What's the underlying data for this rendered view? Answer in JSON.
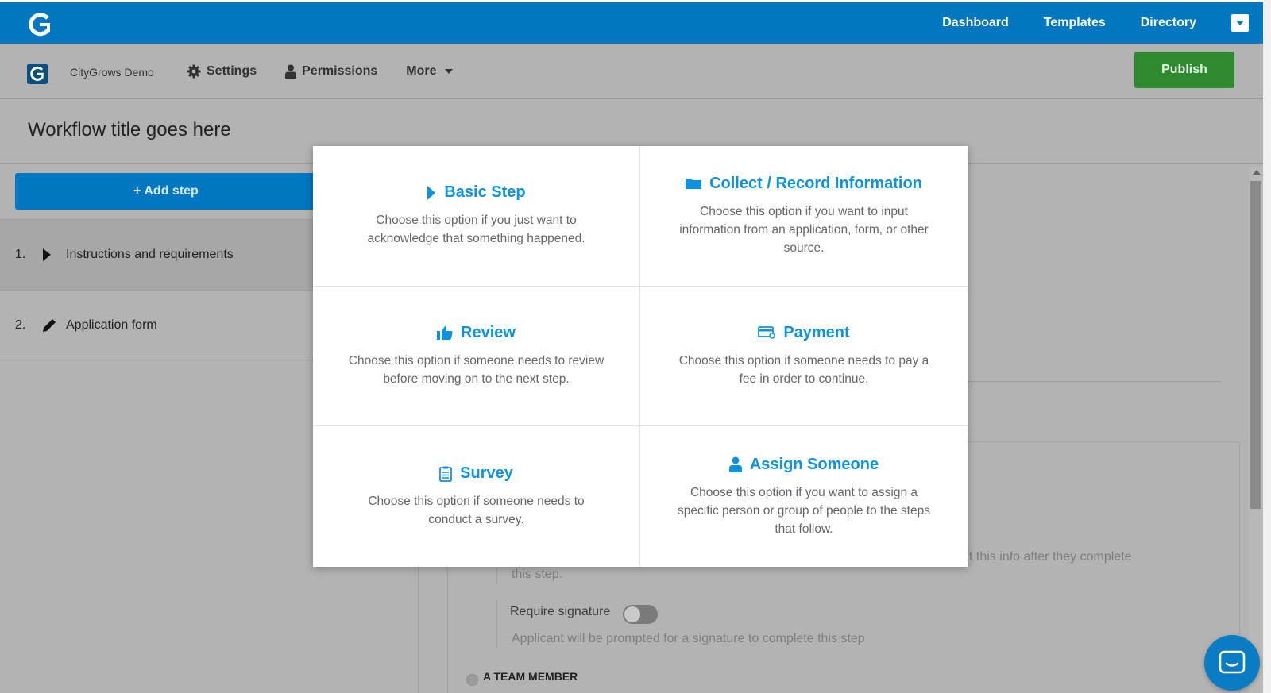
{
  "topnav": {
    "items": [
      "Dashboard",
      "Templates",
      "Directory"
    ]
  },
  "subbar": {
    "org_name": "CityGrows Demo",
    "settings": "Settings",
    "permissions": "Permissions",
    "more": "More",
    "publish": "Publish"
  },
  "workflow": {
    "title": "Workflow title goes here"
  },
  "sidebar": {
    "add_step": "+ Add step",
    "steps": [
      {
        "num": "1.",
        "label": "Instructions and requirements",
        "icon": "play-icon"
      },
      {
        "num": "2.",
        "label": "Application form",
        "icon": "pencil-icon"
      }
    ]
  },
  "background": {
    "edit_note_1": "t this info after they complete",
    "edit_note_2": "this step.",
    "require_signature": "Require signature",
    "signature_note": "Applicant will be prompted for a signature to complete this step",
    "team_member": "A TEAM MEMBER"
  },
  "modal": {
    "options": [
      {
        "title": "Basic Step",
        "icon": "play-icon",
        "desc": "Choose this option if you just want to acknowledge that something happened."
      },
      {
        "title": "Collect / Record Information",
        "icon": "folder-icon",
        "desc": "Choose this option if you want to input information from an application, form, or other source."
      },
      {
        "title": "Review",
        "icon": "thumbs-up-icon",
        "desc": "Choose this option if someone needs to review before moving on to the next step."
      },
      {
        "title": "Payment",
        "icon": "credit-card-icon",
        "desc": "Choose this option if someone needs to pay a fee in order to continue."
      },
      {
        "title": "Survey",
        "icon": "clipboard-icon",
        "desc": "Choose this option if someone needs to conduct a survey."
      },
      {
        "title": "Assign Someone",
        "icon": "user-icon",
        "desc": "Choose this option if you want to assign a specific person or group of people to the steps that follow."
      }
    ]
  },
  "colors": {
    "brand_blue": "#0077c0",
    "link_blue": "#0d93de",
    "publish_green": "#2e8a2e"
  }
}
